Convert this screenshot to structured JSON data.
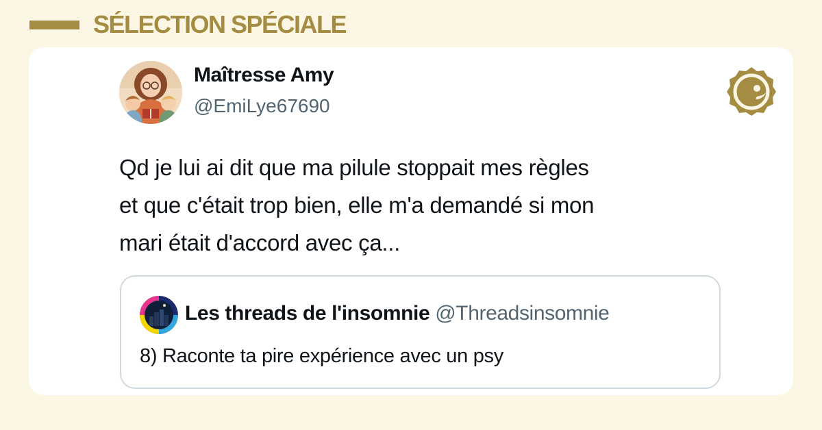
{
  "header": {
    "title": "SÉLECTION SPÉCIALE"
  },
  "tweet": {
    "author_name": "Maîtresse Amy",
    "author_handle": "@EmiLye67690",
    "text_lines": [
      "Qd je lui ai dit que ma pilule stoppait mes règles",
      "et que c'était trop bien, elle m'a demandé si mon",
      "mari était d'accord avec ça..."
    ],
    "avatar_icon": "teacher-reading-avatar-icon",
    "brand_icon": "gold-badge-logo-icon"
  },
  "quote": {
    "author_name": "Les threads de l'insomnie",
    "author_handle": "@Threadsinsomnie",
    "text": "8) Raconte ta pire expérience avec un psy",
    "avatar_icon": "night-city-avatar-icon"
  },
  "colors": {
    "background": "#fbf7e4",
    "accent_gold": "#a58c43",
    "card": "#ffffff",
    "text_primary": "#0f1419",
    "text_secondary": "#536471",
    "quote_border": "#cfd9de"
  }
}
